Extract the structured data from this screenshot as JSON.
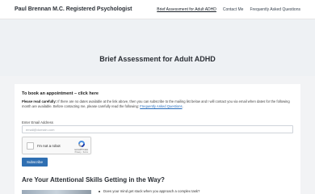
{
  "header": {
    "site_title": "Paul Brennan M.C. Registered Psychologist",
    "nav": [
      {
        "label": "Brief Assessment for Adult ADHD"
      },
      {
        "label": "Contact Me"
      },
      {
        "label": "Frequently Asked Questions"
      }
    ]
  },
  "hero": {
    "title": "Brief Assessment for Adult ADHD"
  },
  "booking": {
    "heading": "To book an appointment – click here",
    "note_lead": "Please read carefully:",
    "note_body": " If there are no dates available at the link above, then you can subscribe to the mailing list below and I will contact you via email when dates for the following month are available. Before contacting me, please carefully read the following: ",
    "note_link": "Frequently Asked Questions",
    "note_end": ".",
    "email_label": "Enter Email Address",
    "email_placeholder": "email@domain.com",
    "captcha_label": "I'm not a robot",
    "captcha_brand": "reCAPTCHA",
    "captcha_terms": "Privacy - Terms",
    "subscribe_label": "Subscribe"
  },
  "section": {
    "heading": "Are Your Attentional Skills Getting in the Way?",
    "bullet": "Does your mind get stuck when you approach a complex task?"
  }
}
